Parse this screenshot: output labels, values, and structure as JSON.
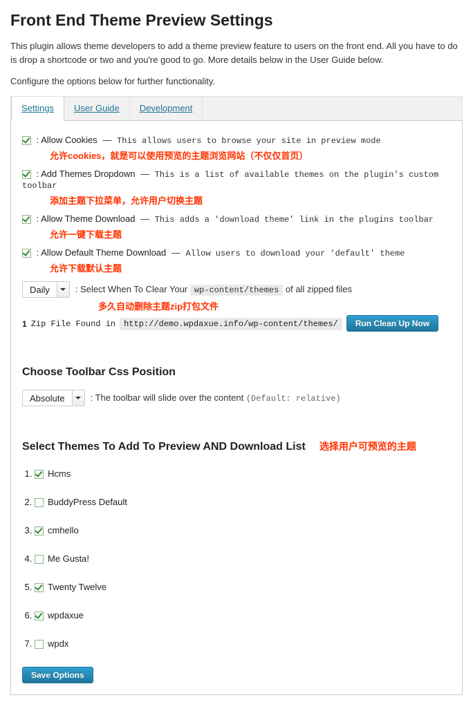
{
  "page": {
    "title": "Front End Theme Preview Settings",
    "intro": "This plugin allows theme developers to add a theme preview feature to users on the front end. All you have to do is drop a shortcode or two and you're good to go. More details below in the User Guide below.",
    "subintro": "Configure the options below for further functionality."
  },
  "tabs": {
    "settings": "Settings",
    "user_guide": "User Guide",
    "development": "Development"
  },
  "options": {
    "cookies": {
      "label": "Allow Cookies",
      "desc": "This allows users to browse your site in preview mode",
      "note": "允许cookies，就是可以使用预览的主题浏览网站（不仅仅首页）"
    },
    "dropdown": {
      "label": "Add Themes Dropdown",
      "desc": "This is a list of available themes on the plugin's custom toolbar",
      "note": "添加主题下拉菜单，允许用户切换主题"
    },
    "download": {
      "label": "Allow Theme Download",
      "desc": "This adds a 'download theme' link in the plugins toolbar",
      "note": "允许一键下载主题"
    },
    "default_dl": {
      "label": "Allow Default Theme Download",
      "desc": "Allow users to download your 'default' theme",
      "note": "允许下载默认主题"
    }
  },
  "clear": {
    "select_value": "Daily",
    "before": ": Select When To Clear Your ",
    "path": "wp-content/themes",
    "after": " of all zipped files",
    "note": "多久自动删除主题zip打包文件",
    "zip_count": "1",
    "zip_text": " Zip File Found in ",
    "zip_url": "http://demo.wpdaxue.info/wp-content/themes/",
    "run_btn": "Run Clean Up Now"
  },
  "toolbar": {
    "heading": "Choose Toolbar Css Position",
    "select_value": "Absolute",
    "desc_main": ": The toolbar will slide over the content ",
    "desc_muted": "(Default: relative)"
  },
  "themes": {
    "heading": "Select Themes To Add To Preview AND Download List",
    "note": "选择用户可预览的主题",
    "items": [
      {
        "name": "Hcms",
        "checked": true
      },
      {
        "name": "BuddyPress Default",
        "checked": false
      },
      {
        "name": "cmhello",
        "checked": true
      },
      {
        "name": "Me Gusta!",
        "checked": false
      },
      {
        "name": "Twenty Twelve",
        "checked": true
      },
      {
        "name": "wpdaxue",
        "checked": true
      },
      {
        "name": "wpdx",
        "checked": false
      }
    ]
  },
  "save": {
    "label": "Save Options"
  }
}
